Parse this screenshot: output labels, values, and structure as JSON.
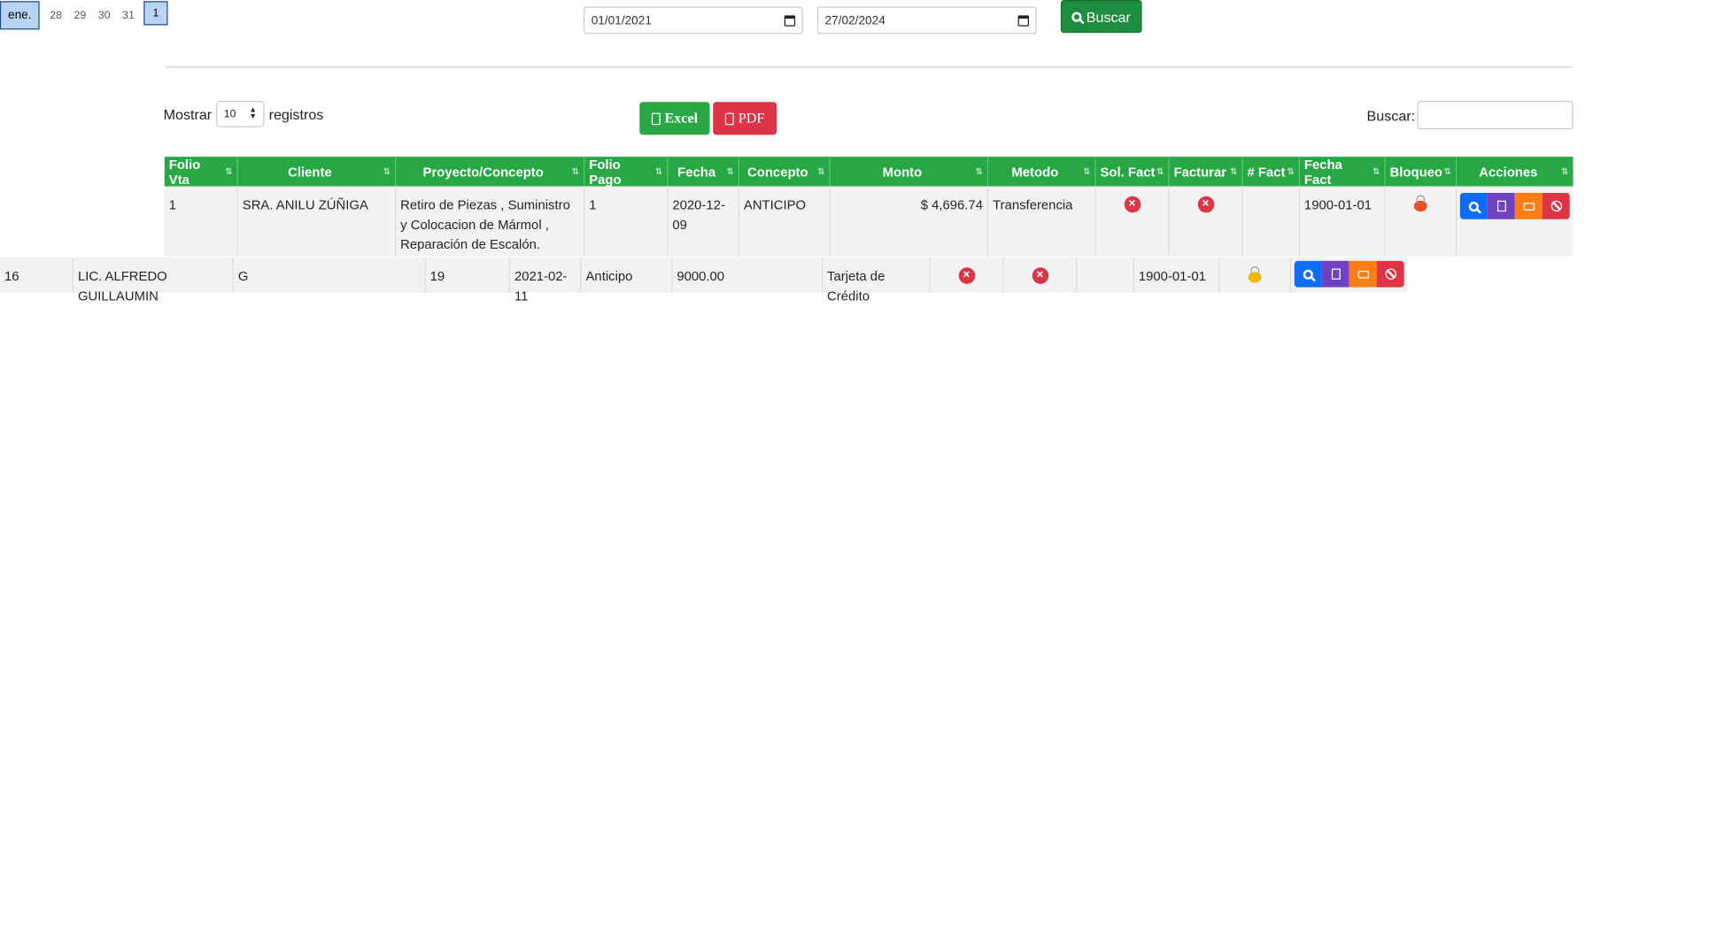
{
  "calendar": {
    "month": "ene.",
    "days": [
      "28",
      "29",
      "30",
      "31"
    ],
    "selected_day": "1"
  },
  "filters": {
    "date_from": "01/01/2021",
    "date_to": "27/02/2024",
    "search_button": "Buscar"
  },
  "controls": {
    "show_label": "Mostrar",
    "page_size": "10",
    "records_label": "registros",
    "excel_label": "Excel",
    "pdf_label": "PDF",
    "search_label": "Buscar:",
    "search_value": ""
  },
  "table": {
    "headers": [
      "Folio Vta",
      "Cliente",
      "Proyecto/Concepto",
      "Folio Pago",
      "Fecha",
      "Concepto",
      "Monto",
      "Metodo",
      "Sol. Fact",
      "Facturar",
      "# Fact",
      "Fecha Fact",
      "Bloqueo",
      "Acciones"
    ],
    "rows": [
      {
        "folio_vta": "1",
        "cliente": "SRA. ANILU ZÚÑIGA",
        "proyecto": "Retiro de Piezas , Suministro y Colocacion de Mármol , Reparación de Escalón.",
        "folio_pago": "1",
        "fecha": "2020-12-09",
        "concepto": "ANTICIPO",
        "monto": "$ 4,696.74",
        "metodo": "Transferencia",
        "num_fact": "",
        "fecha_fact": "1900-01-01",
        "bloqueo": "locked"
      },
      {
        "folio_vta": "16",
        "cliente": "LIC. ALFREDO GUILLAUMIN",
        "proyecto": "G",
        "folio_pago": "19",
        "fecha": "2021-02-11",
        "concepto": "Anticipo",
        "monto": "9000.00",
        "metodo": "Tarjeta de Crédito",
        "num_fact": "",
        "fecha_fact": "1900-01-01",
        "bloqueo": "unlocked"
      }
    ]
  },
  "colors": {
    "header_green": "#28a745",
    "search_green": "#1f8d3f",
    "pdf_red": "#dc3545",
    "action_blue": "#0d6efd",
    "action_purple": "#6f42c1",
    "action_orange": "#fd7e14"
  }
}
